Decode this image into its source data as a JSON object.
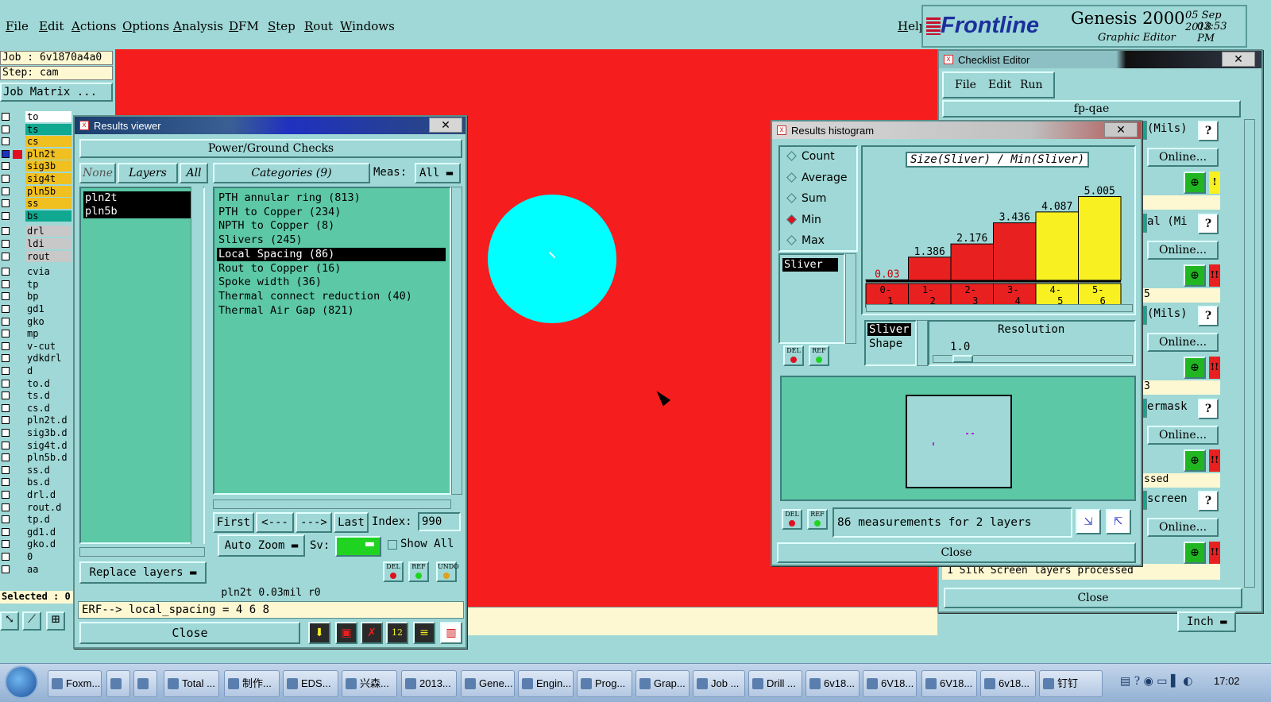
{
  "menu": {
    "file": "File",
    "edit": "Edit",
    "actions": "Actions",
    "options": "Options",
    "analysis": "Analysis",
    "dfm": "DFM",
    "step": "Step",
    "rout": "Rout",
    "windows": "Windows",
    "help": "Help"
  },
  "header": {
    "brand": "Frontline",
    "product": "Genesis 2000",
    "subtitle": "Graphic Editor",
    "date": "05 Sep 2018",
    "time": "03:53 PM"
  },
  "left_panel": {
    "job": "Job : 6v1870a4a0",
    "step": "Step: cam",
    "job_matrix": "Job Matrix ...",
    "layers": [
      {
        "name": "to",
        "color": "#ffffff"
      },
      {
        "name": "ts",
        "color": "#10a890"
      },
      {
        "name": "cs",
        "color": "#f0c020"
      },
      {
        "name": "pln2t",
        "color": "#f0c020",
        "selected": true
      },
      {
        "name": "sig3b",
        "color": "#f0c020"
      },
      {
        "name": "sig4t",
        "color": "#f0c020"
      },
      {
        "name": "pln5b",
        "color": "#f0c020"
      },
      {
        "name": "ss",
        "color": "#f0c020"
      },
      {
        "name": "bs",
        "color": "#10a890"
      },
      {
        "name": "drl",
        "color": "#c8c8c8"
      },
      {
        "name": "ldi",
        "color": "#c8c8c8"
      },
      {
        "name": "rout",
        "color": "#c8c8c8"
      },
      {
        "name": "cvia",
        "color": "#9fd8d6"
      },
      {
        "name": "tp",
        "color": "#9fd8d6"
      },
      {
        "name": "bp",
        "color": "#9fd8d6"
      },
      {
        "name": "gd1",
        "color": "#9fd8d6"
      },
      {
        "name": "gko",
        "color": "#9fd8d6"
      },
      {
        "name": "mp",
        "color": "#9fd8d6"
      },
      {
        "name": "v-cut",
        "color": "#9fd8d6"
      },
      {
        "name": "ydkdrl",
        "color": "#9fd8d6"
      },
      {
        "name": "d",
        "color": "#9fd8d6"
      },
      {
        "name": "to.d",
        "color": "#9fd8d6"
      },
      {
        "name": "ts.d",
        "color": "#9fd8d6"
      },
      {
        "name": "cs.d",
        "color": "#9fd8d6"
      },
      {
        "name": "pln2t.d",
        "color": "#9fd8d6"
      },
      {
        "name": "sig3b.d",
        "color": "#9fd8d6"
      },
      {
        "name": "sig4t.d",
        "color": "#9fd8d6"
      },
      {
        "name": "pln5b.d",
        "color": "#9fd8d6"
      },
      {
        "name": "ss.d",
        "color": "#9fd8d6"
      },
      {
        "name": "bs.d",
        "color": "#9fd8d6"
      },
      {
        "name": "drl.d",
        "color": "#9fd8d6"
      },
      {
        "name": "rout.d",
        "color": "#9fd8d6"
      },
      {
        "name": "tp.d",
        "color": "#9fd8d6"
      },
      {
        "name": "gd1.d",
        "color": "#9fd8d6"
      },
      {
        "name": "gko.d",
        "color": "#9fd8d6"
      },
      {
        "name": "0",
        "color": "#9fd8d6"
      },
      {
        "name": "aa",
        "color": "#9fd8d6"
      }
    ],
    "selected": "Selected : 0"
  },
  "results_viewer": {
    "title": "Results viewer",
    "header": "Power/Ground Checks",
    "none": "None",
    "layers": "Layers",
    "all": "All",
    "categories": "Categories (9)",
    "meas_label": "Meas:",
    "meas_value": "All",
    "layer_items": [
      "pln2t",
      "pln5b"
    ],
    "category_items": [
      "PTH annular ring (813)",
      "PTH to Copper (234)",
      "NPTH to Copper (8)",
      "Slivers (245)",
      "Local Spacing (86)",
      "Rout to Copper (16)",
      "Spoke width (36)",
      "Thermal connect reduction (40)",
      "Thermal Air Gap (821)"
    ],
    "selected_category": "Local Spacing (86)",
    "first": "First",
    "prev": "<---",
    "next": "--->",
    "last": "Last",
    "index_label": "Index:",
    "index_value": "990",
    "auto_zoom": "Auto Zoom",
    "sv": "Sv:",
    "show_all": "Show All",
    "replace_layers": "Replace layers",
    "status": "pln2t 0.03mil  r0",
    "erf": "ERF--> local_spacing = 4 6 8",
    "close": "Close",
    "del": "DEL",
    "ref": "REF",
    "undo": "UNDO"
  },
  "histogram": {
    "title": "Results histogram",
    "modes": [
      "Count",
      "Average",
      "Sum",
      "Min",
      "Max"
    ],
    "selected_mode": "Min",
    "list_item": "Sliver",
    "chart_title": "Size(Sliver) / Min(Sliver)",
    "shape_items": [
      "Sliver",
      "Shape"
    ],
    "resolution_label": "Resolution",
    "resolution_value": "1.0",
    "summary": "86 measurements for 2 layers",
    "close": "Close",
    "del": "DEL",
    "ref": "REF"
  },
  "chart_data": {
    "type": "bar",
    "title": "Size(Sliver) / Min(Sliver)",
    "categories": [
      "0-1",
      "1-2",
      "2-3",
      "3-4",
      "4-5",
      "5-6"
    ],
    "values": [
      0.03,
      1.386,
      2.176,
      3.436,
      4.087,
      5.005
    ],
    "value_labels": [
      "0.03",
      "1.386",
      "2.176",
      "3.436",
      "4.087",
      "5.005"
    ],
    "colors": [
      "#e82020",
      "#e82020",
      "#e82020",
      "#e82020",
      "#f8f020",
      "#f8f020"
    ],
    "ylim": [
      0,
      5.6
    ]
  },
  "checklist": {
    "title": "Checklist Editor",
    "menu": [
      "File",
      "Edit",
      "Run"
    ],
    "name": "fp-qae",
    "rows": [
      {
        "label": "(Mils)",
        "online": "Online...",
        "mark": "!",
        "mark_color": "#f8f020",
        "status": ""
      },
      {
        "label": "al (Mi",
        "online": "Online...",
        "mark": "!!",
        "mark_color": "#e82020",
        "status": "5"
      },
      {
        "label": "(Mils)",
        "online": "Online...",
        "mark": "!!",
        "mark_color": "#e82020",
        "status": "3"
      },
      {
        "label": "ermask",
        "online": "Online...",
        "mark": "!!",
        "mark_color": "#e82020",
        "status": "ssed"
      },
      {
        "label": "screen",
        "online": "Online...",
        "mark": "!!",
        "mark_color": "#e82020",
        "status": "ocessed"
      }
    ],
    "bottom_status": "1 Silk Screen layers processed",
    "close": "Close"
  },
  "units": "Inch",
  "taskbar": {
    "items": [
      "Foxm...",
      "",
      "",
      "Total ...",
      "制作...",
      "EDS...",
      "兴森...",
      "2013...",
      "Gene...",
      "Engin...",
      "Prog...",
      "Grap...",
      "Job ...",
      "Drill ...",
      "6v18...",
      "6V18...",
      "6V18...",
      "6v18...",
      "钉钉"
    ],
    "clock": "17:02"
  }
}
